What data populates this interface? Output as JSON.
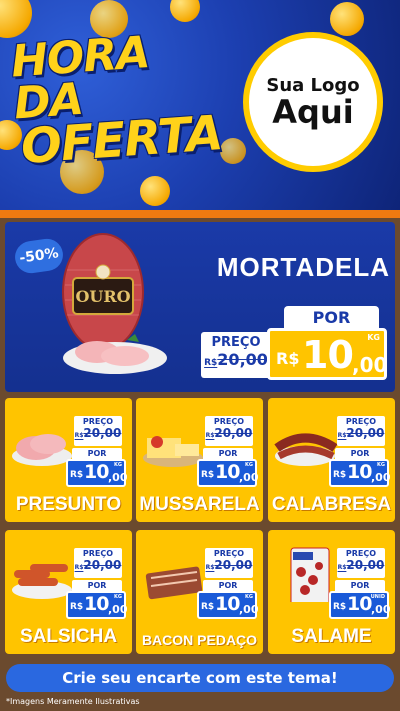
{
  "header": {
    "headline_line1": "HORA DA",
    "headline_line2": "OFERTA",
    "logo_line1": "Sua Logo",
    "logo_line2": "Aqui"
  },
  "featured": {
    "discount": "-50%",
    "name": "MORTADELA",
    "brand_text": "OURO",
    "preco_label": "PREÇO",
    "old_currency": "R$",
    "old_price": "20,00",
    "por_label": "POR",
    "currency": "R$",
    "price_int": "10",
    "price_dec": ",00",
    "unit": "KG"
  },
  "products": [
    {
      "name": "PRESUNTO",
      "preco_label": "PREÇO",
      "old_currency": "R$",
      "old_price": "20,00",
      "por_label": "POR",
      "currency": "R$",
      "price_int": "10",
      "price_dec": ",00",
      "unit": "KG"
    },
    {
      "name": "MUSSARELA",
      "preco_label": "PREÇO",
      "old_currency": "R$",
      "old_price": "20,00",
      "por_label": "POR",
      "currency": "R$",
      "price_int": "10",
      "price_dec": ",00",
      "unit": "KG"
    },
    {
      "name": "CALABRESA",
      "preco_label": "PREÇO",
      "old_currency": "R$",
      "old_price": "20,00",
      "por_label": "POR",
      "currency": "R$",
      "price_int": "10",
      "price_dec": ",00",
      "unit": "KG"
    },
    {
      "name": "SALSICHA",
      "preco_label": "PREÇO",
      "old_currency": "R$",
      "old_price": "20,00",
      "por_label": "POR",
      "currency": "R$",
      "price_int": "10",
      "price_dec": ",00",
      "unit": "KG"
    },
    {
      "name": "BACON PEDAÇO",
      "preco_label": "PREÇO",
      "old_currency": "R$",
      "old_price": "20,00",
      "por_label": "POR",
      "currency": "R$",
      "price_int": "10",
      "price_dec": ",00",
      "unit": "KG"
    },
    {
      "name": "SALAME",
      "preco_label": "PREÇO",
      "old_currency": "R$",
      "old_price": "20,00",
      "por_label": "POR",
      "currency": "R$",
      "price_int": "10",
      "price_dec": ",00",
      "unit": "UNID"
    }
  ],
  "cta": "Crie seu encarte com este tema!",
  "disclaimer": "*Imagens Meramente Ilustrativas",
  "colors": {
    "header_blue": "#1c3fb0",
    "headline_yellow": "#ffd21a",
    "card_yellow": "#ffc400",
    "price_blue": "#1a5ad8",
    "wood_brown": "#6b4a2e",
    "accent_orange": "#f07a10"
  }
}
